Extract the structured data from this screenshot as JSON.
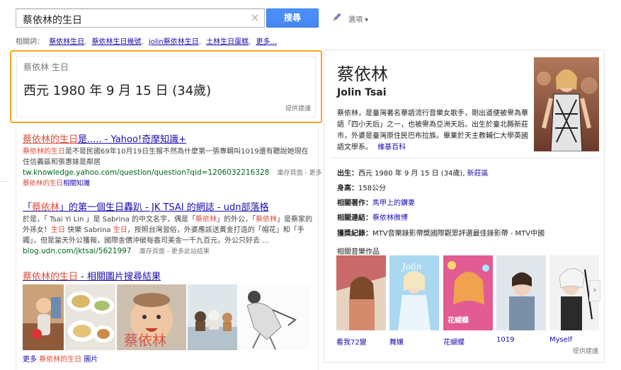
{
  "search": {
    "query": "蔡依林的生日",
    "clear": "×",
    "button": "搜尋",
    "options": "選項 ▾"
  },
  "related": {
    "label": "相關詞：",
    "items": [
      "蔡依林生日",
      "蔡依林生日幾號",
      "jolin蔡依林生日",
      "土林生日蛋糕"
    ],
    "more": "更多..."
  },
  "answer": {
    "title": "蔡依林 生日",
    "value": "西元 1980 年 9 月 15 日 (34歲)",
    "feedback": "提供建議"
  },
  "results": [
    {
      "title_em": "蔡依林的生日",
      "title_rest": "是..... - Yahoo!奇摩知識+",
      "snippet_em": "蔡依林的生日",
      "snippet_rest": "是不是民國69年10月19日生猴不然為什麼第一張專輯叫1019還有聽說她現在住信義區和張惠妹是鄰居",
      "url": "tw.knowledge.yahoo.com/question/question?qid=1206032216328",
      "cache": "庫存頁面",
      "more": "更多",
      "sub_em": "蔡依林的生日",
      "sub_rest": "相關知識"
    },
    {
      "title_pre": "「",
      "title_em": "蔡依林",
      "title_rest": "」的第一個生日轟趴 - JK TSAI 的網誌 - udn部落格",
      "snippet": [
        {
          "t": "於是，「 Tsai Yi Lin 」是 Sabrina 的中文名字，偶是「",
          "em": false
        },
        {
          "t": "蔡依林",
          "em": true
        },
        {
          "t": "」的外公，「",
          "em": false
        },
        {
          "t": "蔡依林",
          "em": true
        },
        {
          "t": "」是蔡家的外孫女！",
          "em": false
        },
        {
          "t": "生日",
          "em": true
        },
        {
          "t": " 快樂 Sabrina ",
          "em": false
        },
        {
          "t": "生日",
          "em": true
        },
        {
          "t": "，按照台灣習俗，外婆應該送黃金打造的「帽花」和「手鐲」，但是當天外公獲報，國際金價沖破每盎司美金一千九百元，外公只好去 ...",
          "em": false
        }
      ],
      "url": "blog.udn.com/jktsai/5621997",
      "cache": "庫存頁面",
      "more": "更多此站結果"
    },
    {
      "title_em": "蔡依林的生日",
      "title_rest": " - 相關圖片搜尋結果"
    }
  ],
  "image_more": {
    "prefix": "更多",
    "em": "蔡依林的生日",
    "suffix": "圖片"
  },
  "knowledge_panel": {
    "name": "蔡依林",
    "english_name": "Jolin Tsai",
    "description": "蔡依林，是臺灣著名華語流行音樂女歌手，剛出道便被譽為華語「四小天后」之一，也被譽為亞洲天后。出生於臺北縣新莊市，外婆是臺灣原住民巴布拉族。畢業於天主教輔仁大學英國語文學系。",
    "desc_link": "維基百科",
    "facts": [
      {
        "label": "出生：",
        "value": "西元 1980 年 9 月 15 日 (34歲), ",
        "link": "新莊區"
      },
      {
        "label": "身高：",
        "value": "158公分",
        "link": ""
      },
      {
        "label": "相關著作：",
        "value": "",
        "link": "馬甲上的鑽妻"
      },
      {
        "label": "相關連結：",
        "value": "",
        "link": "蔡依林微博"
      },
      {
        "label": "獲獎紀錄：",
        "value": "MTV音樂錄影帶獎國際觀眾評選最佳錄影帶 - MTV中國",
        "link": ""
      }
    ],
    "albums_title": "相關音樂作品",
    "albums": [
      "看我72變",
      "舞孃",
      "花蝴蝶",
      "1019",
      "Myself"
    ],
    "next": "›",
    "feedback": "提供建議"
  },
  "colors": {
    "link": "#1a0dab",
    "highlight": "#dd4b39",
    "url": "#006621",
    "answer_border": "#f5a623",
    "button": "#4d90fe"
  }
}
